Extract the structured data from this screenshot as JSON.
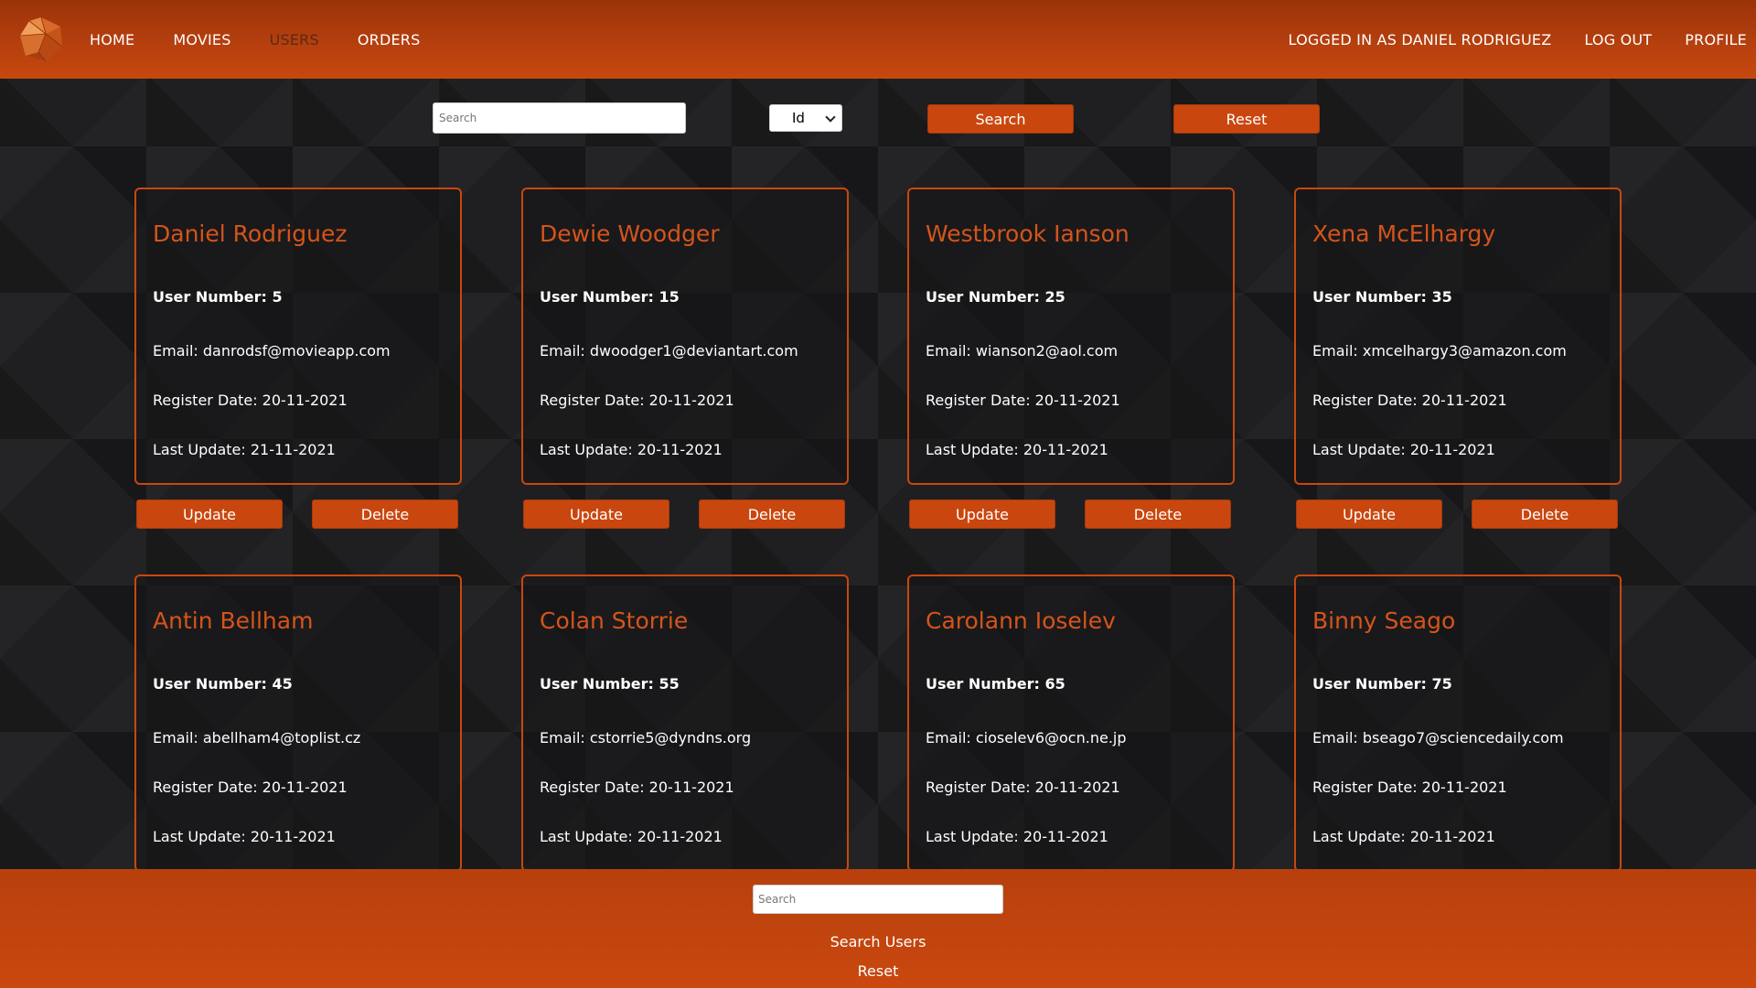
{
  "nav": {
    "logo_icon": "faceted-gem-logo-icon",
    "links": [
      "HOME",
      "MOVIES",
      "USERS",
      "ORDERS"
    ],
    "active_index": 2,
    "logged_in": "LOGGED IN AS DANIEL RODRIGUEZ",
    "logout": "LOG OUT",
    "profile": "PROFILE"
  },
  "search": {
    "placeholder": "Search",
    "select_value": "Id",
    "search_button": "Search",
    "reset_button": "Reset"
  },
  "cards": [
    {
      "name": "Daniel Rodriguez",
      "user_number": "User Number: 5",
      "email": "Email: danrodsf@movieapp.com",
      "register": "Register Date: 20-11-2021",
      "last_update": "Last Update: 21-11-2021"
    },
    {
      "name": "Dewie Woodger",
      "user_number": "User Number: 15",
      "email": "Email: dwoodger1@deviantart.com",
      "register": "Register Date: 20-11-2021",
      "last_update": "Last Update: 20-11-2021"
    },
    {
      "name": "Westbrook Ianson",
      "user_number": "User Number: 25",
      "email": "Email: wianson2@aol.com",
      "register": "Register Date: 20-11-2021",
      "last_update": "Last Update: 20-11-2021"
    },
    {
      "name": "Xena McElhargy",
      "user_number": "User Number: 35",
      "email": "Email: xmcelhargy3@amazon.com",
      "register": "Register Date: 20-11-2021",
      "last_update": "Last Update: 20-11-2021"
    },
    {
      "name": "Antin Bellham",
      "user_number": "User Number: 45",
      "email": "Email: abellham4@toplist.cz",
      "register": "Register Date: 20-11-2021",
      "last_update": "Last Update: 20-11-2021"
    },
    {
      "name": "Colan Storrie",
      "user_number": "User Number: 55",
      "email": "Email: cstorrie5@dyndns.org",
      "register": "Register Date: 20-11-2021",
      "last_update": "Last Update: 20-11-2021"
    },
    {
      "name": "Carolann Ioselev",
      "user_number": "User Number: 65",
      "email": "Email: cioselev6@ocn.ne.jp",
      "register": "Register Date: 20-11-2021",
      "last_update": "Last Update: 20-11-2021"
    },
    {
      "name": "Binny Seago",
      "user_number": "User Number: 75",
      "email": "Email: bseago7@sciencedaily.com",
      "register": "Register Date: 20-11-2021",
      "last_update": "Last Update: 20-11-2021"
    }
  ],
  "card_actions": {
    "update": "Update",
    "delete": "Delete"
  },
  "footer": {
    "placeholder": "Search",
    "search_link": "Search Users",
    "reset_link": "Reset"
  },
  "colors": {
    "accent": "#c9470f",
    "name_text": "#d5541a",
    "active_nav": "#5a2a16"
  }
}
